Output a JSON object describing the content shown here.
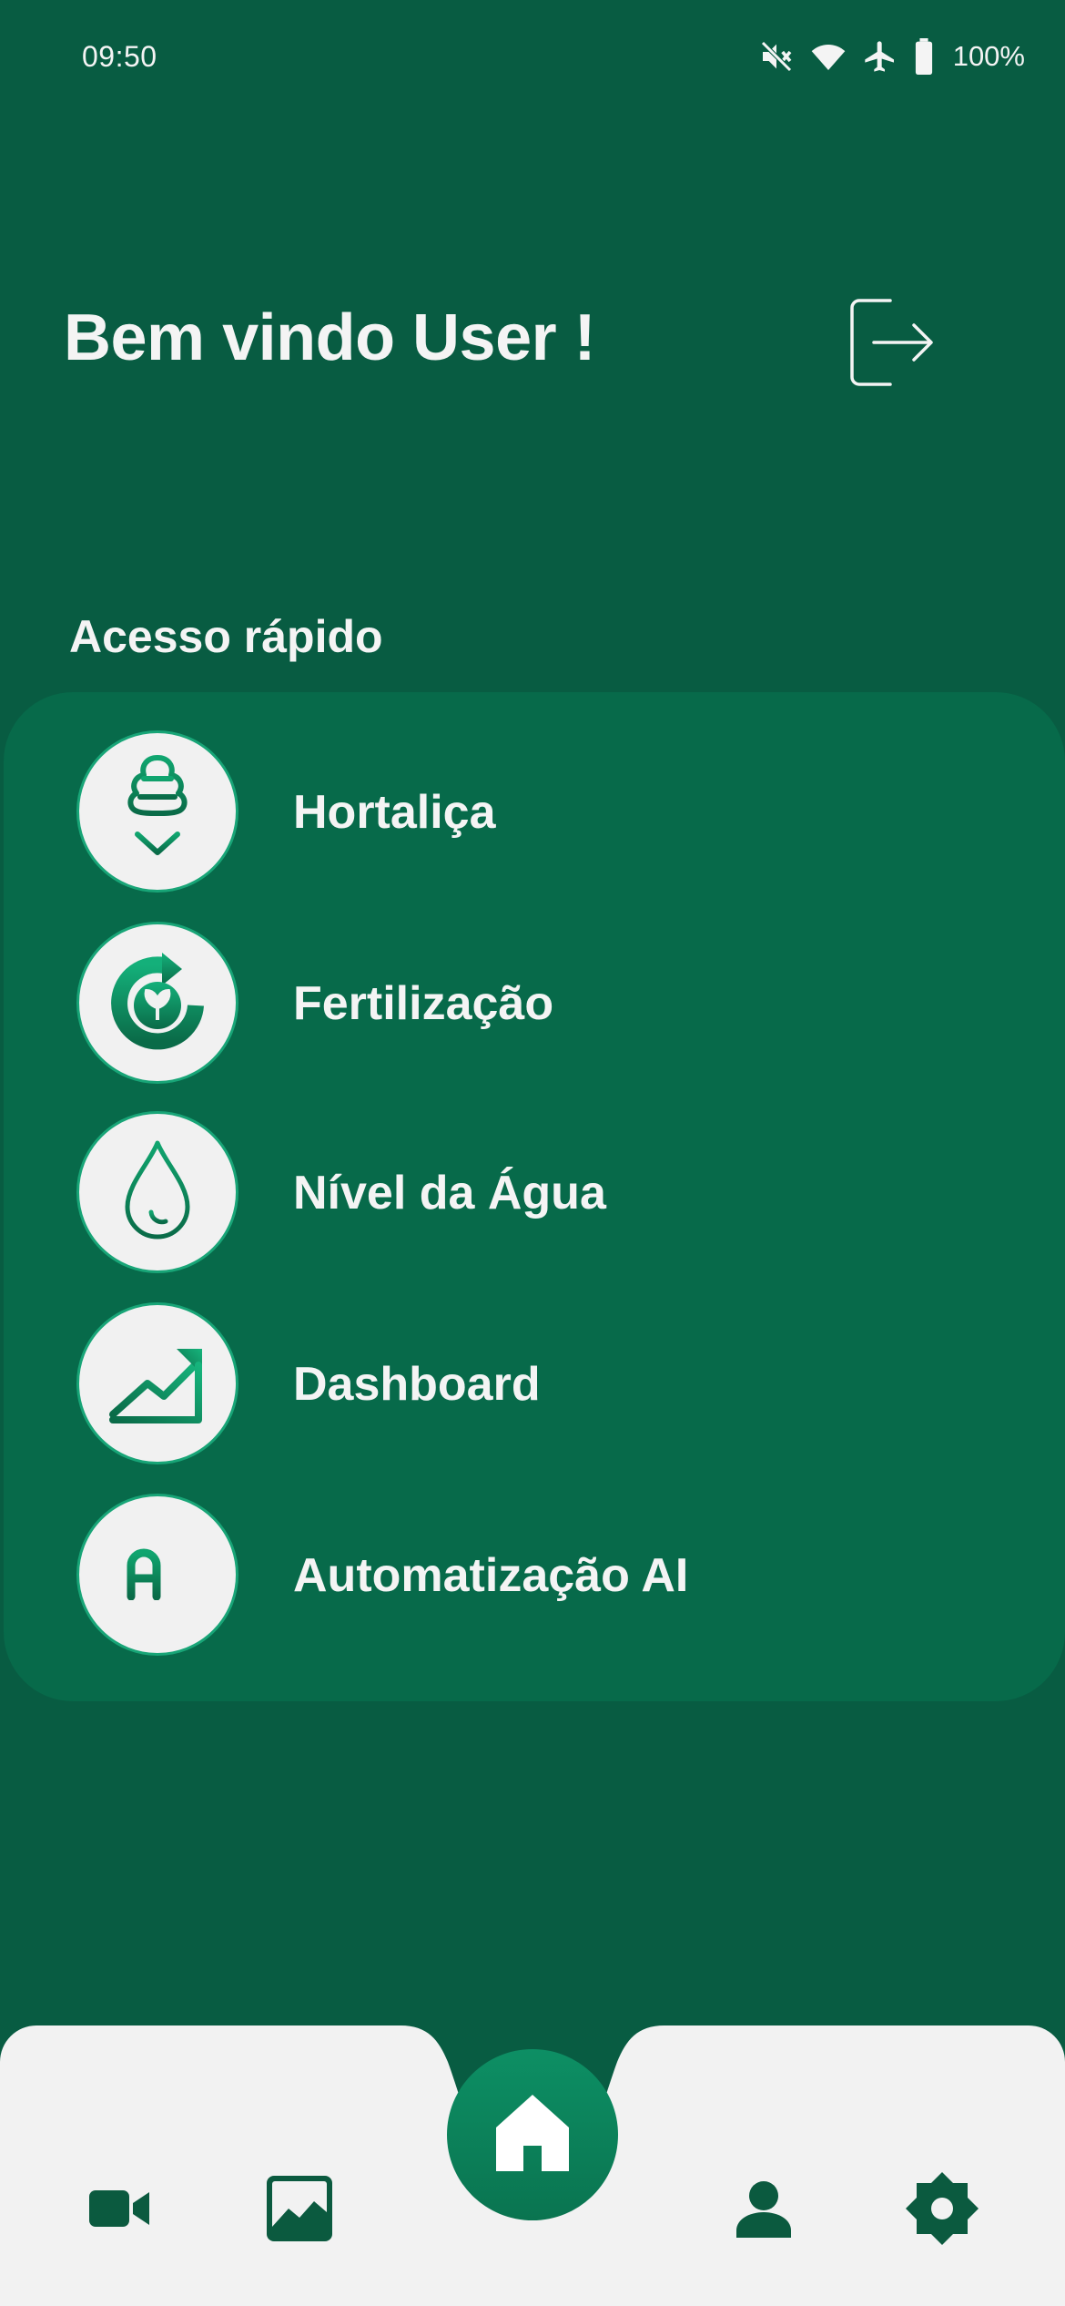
{
  "status_bar": {
    "time": "09:50",
    "battery": "100%",
    "icons": [
      "mute-icon",
      "wifi-icon",
      "airplane-icon",
      "battery-icon"
    ]
  },
  "header": {
    "welcome": "Bem vindo User !",
    "logout_icon": "logout-icon"
  },
  "quick_access": {
    "title": "Acesso rápido",
    "items": [
      {
        "label": "Hortaliça",
        "icon": "plant-icon"
      },
      {
        "label": "Fertilização",
        "icon": "fertilize-cycle-icon"
      },
      {
        "label": "Nível da Água",
        "icon": "water-drop-icon"
      },
      {
        "label": "Dashboard",
        "icon": "trend-chart-icon"
      },
      {
        "label": "Automatização AI",
        "icon": "ai-text-icon",
        "icon_text": "AI"
      }
    ]
  },
  "bottom_nav": {
    "items": [
      "video-camera-icon",
      "image-gallery-icon",
      "home-icon",
      "user-icon",
      "settings-gear-icon"
    ],
    "active": "home-icon"
  },
  "colors": {
    "background": "#085c42",
    "panel": "#076a4a",
    "accent": "#18a577",
    "nav_background": "#f2f2f2",
    "icon_dark": "#0b5a3f"
  }
}
